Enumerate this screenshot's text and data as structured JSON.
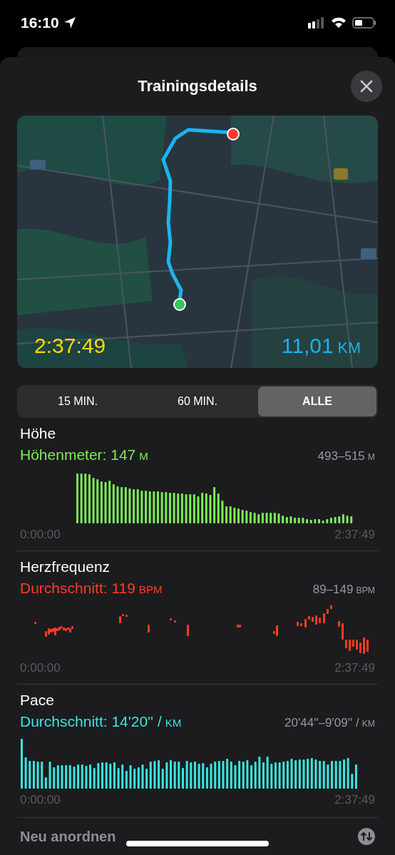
{
  "status_bar": {
    "time": "16:10"
  },
  "sheet": {
    "title": "Trainingsdetails"
  },
  "map": {
    "kind": "picture",
    "duration": "2:37:49",
    "distance": "11,01",
    "distance_unit": "KM"
  },
  "range_tabs": [
    {
      "label": "15 MIN.",
      "selected": false
    },
    {
      "label": "60 MIN.",
      "selected": false
    },
    {
      "label": "ALLE",
      "selected": true
    }
  ],
  "metrics": [
    {
      "kind": "elevation",
      "title": "Höhe",
      "summary": "Höhenmeter: 147",
      "summary_unit": "M",
      "color": "#7ced57",
      "range": "493–515",
      "range_unit": "M",
      "start": "0:00:00",
      "end": "2:37:49"
    },
    {
      "kind": "heart",
      "title": "Herzfrequenz",
      "summary": "Durchschnitt: 119",
      "summary_unit": "BPM",
      "color": "#ff3b22",
      "range": "89–149",
      "range_unit": "BPM",
      "start": "0:00:00",
      "end": "2:37:49"
    },
    {
      "kind": "pace",
      "title": "Pace",
      "summary": "Durchschnitt: 14'20'' /",
      "summary_unit": "KM",
      "color": "#3ae6e0",
      "range": "20'44''–9'09'' /",
      "range_unit": "KM",
      "start": "0:00:00",
      "end": "2:37:49"
    }
  ],
  "footer": {
    "label": "Neu anordnen"
  }
}
